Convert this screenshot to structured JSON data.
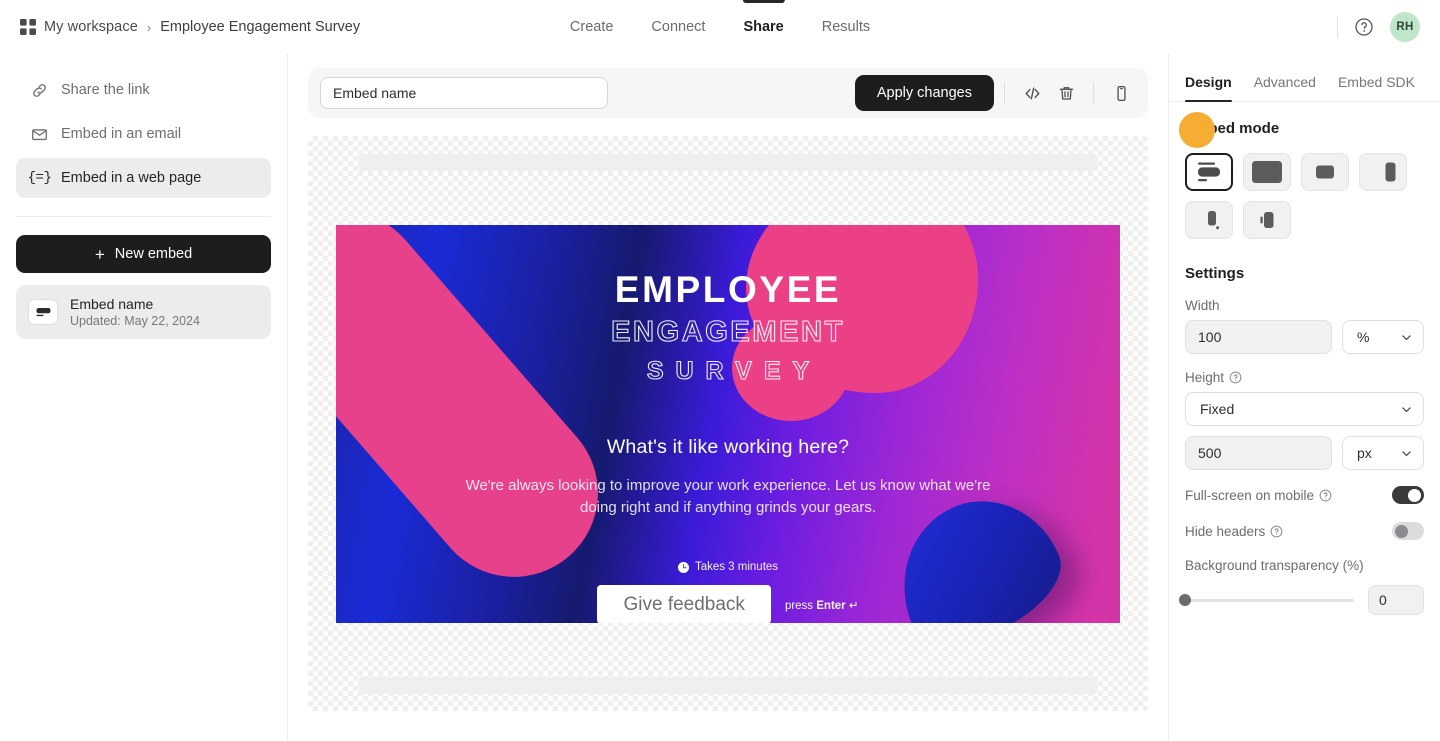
{
  "header": {
    "workspace": "My workspace",
    "separator": "›",
    "project": "Employee Engagement Survey",
    "grid_icon": "grid-icon",
    "help_icon": "help-circle-icon",
    "avatar_initials": "RH",
    "avatar_color": "#bfe6c8",
    "tabs": [
      {
        "label": "Create",
        "active": false
      },
      {
        "label": "Connect",
        "active": false
      },
      {
        "label": "Share",
        "active": true
      },
      {
        "label": "Results",
        "active": false
      }
    ]
  },
  "sidebar": {
    "items": [
      {
        "label": "Share the link",
        "icon": "link-icon",
        "active": false
      },
      {
        "label": "Embed in an email",
        "icon": "envelope-icon",
        "active": false
      },
      {
        "label": "Embed in a web page",
        "icon": "embed-code-icon",
        "active": true
      }
    ],
    "new_embed_label": "New embed",
    "new_embed_plus": "+",
    "embed_card": {
      "title": "Embed name",
      "subtitle": "Updated: May 22, 2024",
      "thumb_icon": "embed-thumbnail-icon"
    }
  },
  "toolbar": {
    "name_value": "Embed name",
    "name_placeholder": "Embed name",
    "apply_label": "Apply changes",
    "icons": [
      {
        "name": "code-icon",
        "glyph": "</>"
      },
      {
        "name": "trash-icon",
        "glyph": "trash"
      },
      {
        "name": "mobile-preview-icon",
        "glyph": "mobile"
      }
    ],
    "cursor_color": "#f5ad34"
  },
  "preview": {
    "survey": {
      "title_line1": "EMPLOYEE",
      "title_line2": "ENGAGEMENT",
      "title_line3": "SURVEY",
      "headline": "What's it like working here?",
      "body": "We're always looking to improve your work experience. Let us know what we're doing right and if anything grinds your gears.",
      "takes_label": "Takes 3 minutes",
      "clock_icon": "clock-icon",
      "cta_label": "Give feedback",
      "press_prefix": "press ",
      "press_key": "Enter",
      "press_arrow": "↵",
      "colors": {
        "gradient_start": "#1c24a8",
        "gradient_end": "#d534a8",
        "pink_shape": "#ec4086",
        "blue_shape": "#1f2fd8"
      }
    }
  },
  "panel": {
    "tabs": [
      {
        "label": "Design",
        "active": true
      },
      {
        "label": "Advanced",
        "active": false
      },
      {
        "label": "Embed SDK",
        "active": false
      }
    ],
    "embed_mode_heading": "Embed mode",
    "modes": [
      {
        "name": "mode-standard",
        "selected": true
      },
      {
        "name": "mode-full-width",
        "selected": false
      },
      {
        "name": "mode-popup",
        "selected": false
      },
      {
        "name": "mode-side-panel",
        "selected": false
      },
      {
        "name": "mode-popover",
        "selected": false
      },
      {
        "name": "mode-side-tab",
        "selected": false
      }
    ],
    "settings_heading": "Settings",
    "width_label": "Width",
    "width_value": "100",
    "width_unit": "%",
    "height_label": "Height",
    "height_help_icon": "help-circle-icon",
    "height_mode": "Fixed",
    "height_value": "500",
    "height_unit": "px",
    "fullscreen_label": "Full-screen on mobile",
    "fullscreen_on": true,
    "hide_headers_label": "Hide headers",
    "hide_headers_on": false,
    "transparency_label": "Background transparency (%)",
    "transparency_value": "0",
    "transparency_percent": 0
  }
}
